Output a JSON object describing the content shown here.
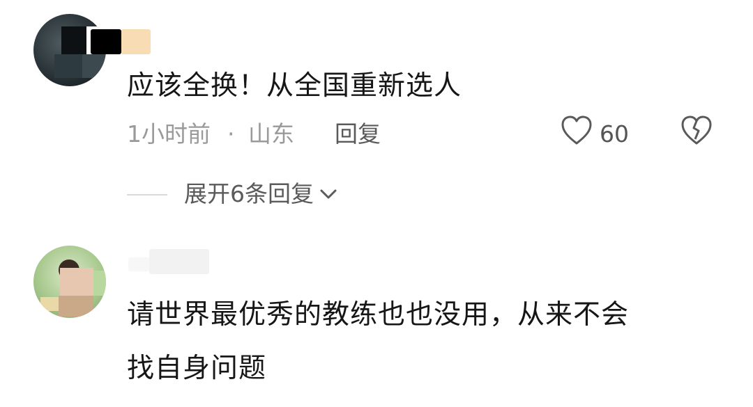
{
  "comments": [
    {
      "text": "应该全换！从全国重新选人",
      "time": "1小时前",
      "separator": "·",
      "location": "山东",
      "reply_label": "回复",
      "likes": "60",
      "expand_label": "展开6条回复",
      "icons": {
        "like": "heart-icon",
        "dislike": "broken-heart-icon",
        "expand": "chevron-down-icon"
      }
    },
    {
      "text_line1": "请世界最优秀的教练也也没用，从来不会",
      "text_line2": "找自身问题"
    }
  ]
}
